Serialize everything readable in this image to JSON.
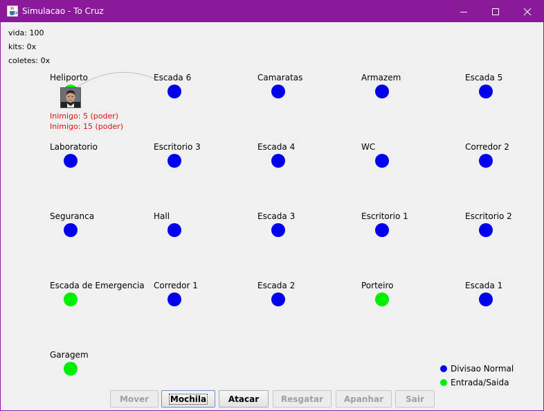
{
  "window": {
    "title": "Simulacao - To Cruz",
    "colors": {
      "titlebar": "#8b1a9a",
      "normal": "#0000ee",
      "exit": "#00ee00",
      "enemy": "#e01010"
    }
  },
  "stats": {
    "vida": "vida: 100",
    "kits": "kits: 0x",
    "coletes": "coletes: 0x"
  },
  "rooms": [
    {
      "name": "Heliporto",
      "type": "exit"
    },
    {
      "name": "Escada 6",
      "type": "normal"
    },
    {
      "name": "Camaratas",
      "type": "normal"
    },
    {
      "name": "Armazem",
      "type": "normal"
    },
    {
      "name": "Escada 5",
      "type": "normal"
    },
    {
      "name": "Laboratorio",
      "type": "normal"
    },
    {
      "name": "Escritorio 3",
      "type": "normal"
    },
    {
      "name": "Escada 4",
      "type": "normal"
    },
    {
      "name": "WC",
      "type": "normal"
    },
    {
      "name": "Corredor 2",
      "type": "normal"
    },
    {
      "name": "Seguranca",
      "type": "normal"
    },
    {
      "name": "Hall",
      "type": "normal"
    },
    {
      "name": "Escada 3",
      "type": "normal"
    },
    {
      "name": "Escritorio 1",
      "type": "normal"
    },
    {
      "name": "Escritorio 2",
      "type": "normal"
    },
    {
      "name": "Escada de Emergencia",
      "type": "exit"
    },
    {
      "name": "Corredor 1",
      "type": "normal"
    },
    {
      "name": "Escada 2",
      "type": "normal"
    },
    {
      "name": "Porteiro",
      "type": "exit"
    },
    {
      "name": "Escada 1",
      "type": "normal"
    },
    {
      "name": "Garagem",
      "type": "exit"
    }
  ],
  "player_room": "Heliporto",
  "enemies": [
    "Inimigo: 5 (poder)",
    "Inimigo: 15 (poder)"
  ],
  "legend": {
    "normal": "Divisao Normal",
    "exit": "Entrada/Saida"
  },
  "buttons": {
    "mover": "Mover",
    "mochila": "Mochila",
    "atacar": "Atacar",
    "resgatar": "Resgatar",
    "apanhar": "Apanhar",
    "sair": "Sair"
  }
}
